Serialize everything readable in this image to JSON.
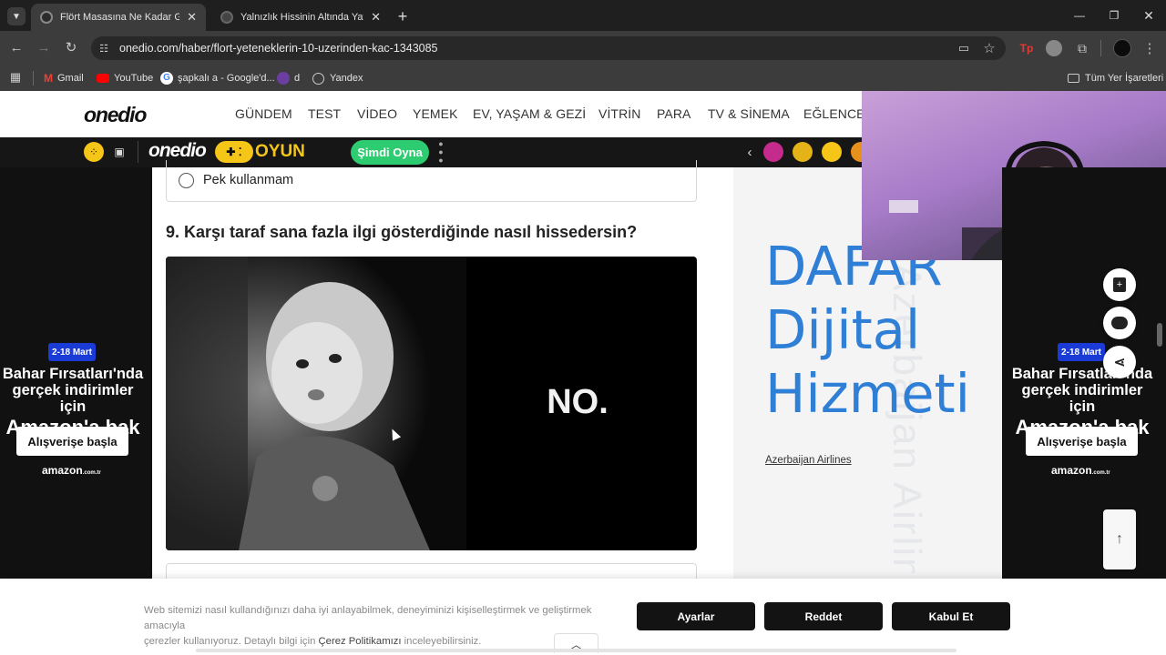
{
  "browser": {
    "tabs": [
      {
        "title": "Flört Masasına Ne Kadar Güçlü",
        "active": true
      },
      {
        "title": "Yalnızlık Hissinin Altında Yatan",
        "active": false
      }
    ],
    "url": "onedio.com/haber/flort-yeteneklerin-10-uzerinden-kac-1343085",
    "bookmarks": [
      "Gmail",
      "YouTube",
      "şapkalı a - Google'd...",
      "d",
      "Yandex"
    ],
    "all_bookmarks_label": "Tüm Yer İşaretleri",
    "window_controls": [
      "minimize",
      "restore",
      "close"
    ],
    "colors": {
      "frame": "#1f1f1f",
      "toolbar": "#3c3c3c",
      "omnibox": "#282828"
    }
  },
  "site": {
    "logo": "onedio",
    "nav": [
      "GÜNDEM",
      "TEST",
      "VİDEO",
      "YEMEK",
      "EV, YAŞAM & GEZİ",
      "VİTRİN",
      "PARA",
      "TV & SİNEMA",
      "EĞLENCE"
    ],
    "game_bar": {
      "logo": "onedio",
      "oyun_label": "OYUN",
      "play_button": "Şimdi Oyna"
    },
    "colors": {
      "oyun_yellow": "#f5c518",
      "play_green": "#2ecc71"
    }
  },
  "quiz": {
    "prev_option": "Pek kullanmam",
    "question": "9. Karşı taraf sana fazla ilgi gösterdiğinde nasıl hissedersin?",
    "image_caption": "NO."
  },
  "ads": {
    "badge": "2-18 Mart",
    "headline_1": "Bahar Fırsatları'nda",
    "headline_2": "gerçek indirimler için",
    "headline_3": "Amazon'a bak",
    "cta": "Alışverişe başla",
    "brand": "amazon",
    "brand_suffix": ".com.tr",
    "colors": {
      "badge": "#1a3bd6"
    }
  },
  "side_ad": {
    "line_1": "DAFAR",
    "line_2": "Dijital",
    "line_3": "Hizmeti",
    "watermark": "Azerbaijan Airlines",
    "link": "Azerbaijan Airlines",
    "colors": {
      "text": "#2f7fd6"
    }
  },
  "cookie_banner": {
    "text_1": "Web sitemizi nasıl kullandığınızı daha iyi anlayabilmek, deneyiminizi kişiselleştirmek ve geliştirmek amacıyla",
    "text_2a": "çerezler kullanıyoruz. Detaylı bilgi için ",
    "policy_link": "Çerez Politikamızı",
    "text_2b": " inceleyebilirsiniz.",
    "buttons": [
      "Ayarlar",
      "Reddet",
      "Kabul Et"
    ]
  }
}
